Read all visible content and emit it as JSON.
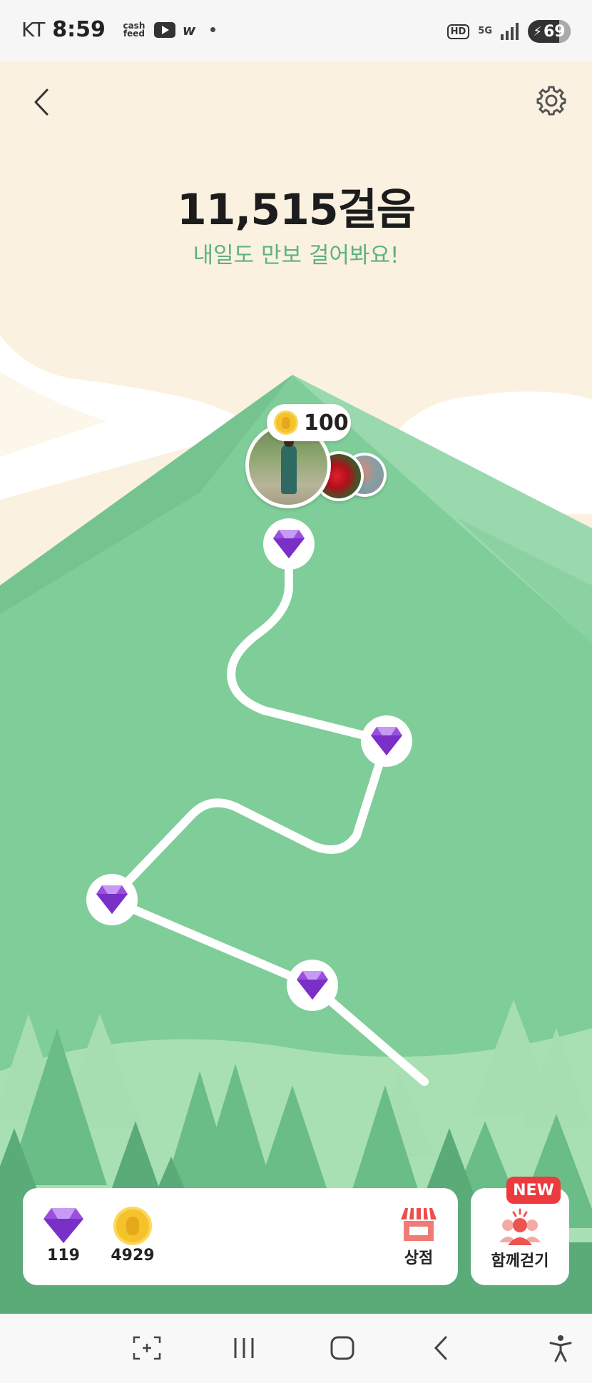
{
  "status_bar": {
    "carrier": "KT",
    "time": "8:59",
    "cashfeed_icon_text": "cash feed",
    "battery": "69",
    "hd_label": "HD",
    "network": "5G"
  },
  "header": {
    "steps": "11,515걸음",
    "subtitle": "내일도 만보 걸어봐요!"
  },
  "summit": {
    "coin_reward": "100"
  },
  "bottom_panel": {
    "gems_count": "119",
    "coins_count": "4929",
    "shop_label": "상점",
    "together_label": "함께걷기",
    "new_badge": "NEW"
  },
  "colors": {
    "sky": "#fbf1e0",
    "mountain": "#7fcd98",
    "subtitle": "#5db37d",
    "gem": "#9b4fe0",
    "coin": "#f6c22b",
    "new_badge": "#ec3a3f"
  },
  "icons": {
    "back": "back-arrow-icon",
    "settings": "gear-icon",
    "gem": "gem-icon",
    "coin": "coin-icon",
    "shop": "shop-icon",
    "together": "group-walk-icon"
  }
}
